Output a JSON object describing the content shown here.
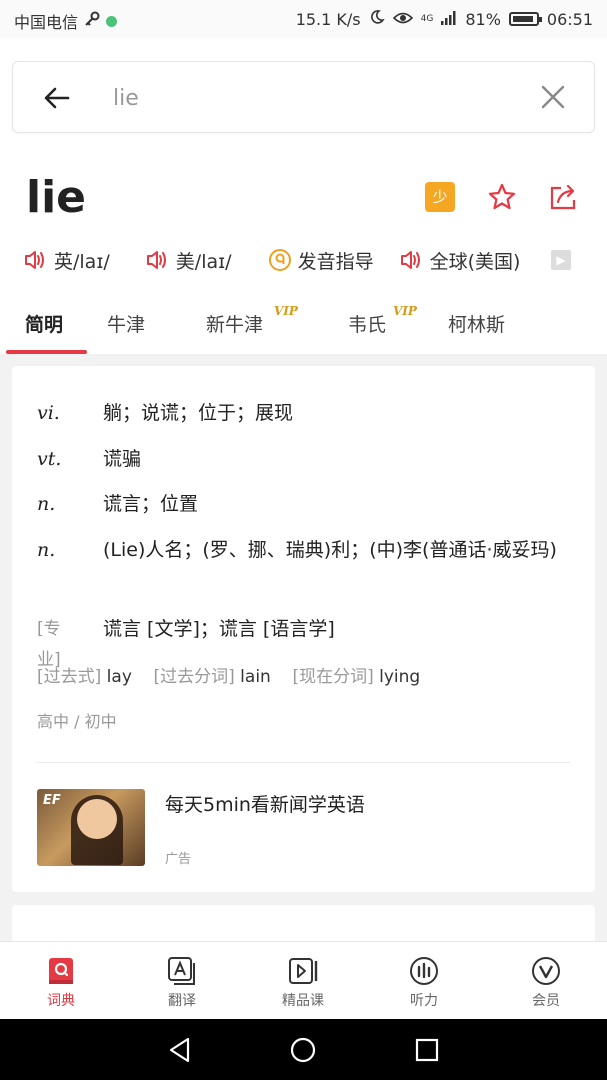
{
  "status_bar": {
    "carrier": "中国电信",
    "speed": "15.1 K/s",
    "network": "4G",
    "battery": "81%",
    "time": "06:51"
  },
  "search": {
    "value": "lie",
    "back_icon": "arrow-left-icon",
    "clear_icon": "close-icon"
  },
  "word": {
    "headword": "lie",
    "badge": "少"
  },
  "pronunciations": [
    {
      "label": "英/laɪ/",
      "icon": "speaker-icon"
    },
    {
      "label": "美/laɪ/",
      "icon": "speaker-icon"
    },
    {
      "label": "发音指导",
      "icon": "pronunciation-guide-icon"
    },
    {
      "label": "全球(美国)",
      "icon": "speaker-icon"
    }
  ],
  "tabs": [
    {
      "label": "简明",
      "vip": ""
    },
    {
      "label": "牛津",
      "vip": ""
    },
    {
      "label": "新牛津",
      "vip": "VIP"
    },
    {
      "label": "韦氏",
      "vip": "VIP"
    },
    {
      "label": "柯林斯",
      "vip": ""
    }
  ],
  "definitions": [
    {
      "pos": "vi.",
      "meaning": "躺；说谎；位于；展现"
    },
    {
      "pos": "vt.",
      "meaning": "谎骗"
    },
    {
      "pos": "n.",
      "meaning": "谎言；位置"
    },
    {
      "pos": "n.",
      "meaning": "(Lie)人名；(罗、挪、瑞典)利；(中)李(普通话·威妥玛)"
    }
  ],
  "specialty": {
    "tag": "[专业]",
    "meaning": "谎言 [文学]；谎言 [语言学]"
  },
  "forms": {
    "past_label": "[过去式]",
    "past": "lay",
    "pp_label": "[过去分词]",
    "pp": "lain",
    "pres_label": "[现在分词]",
    "pres": "lying"
  },
  "level": "高中 / 初中",
  "ad": {
    "brand": "EF",
    "title": "每天5min看新闻学英语",
    "label": "广告"
  },
  "bottom_nav": [
    {
      "label": "词典",
      "icon": "dictionary-icon",
      "active": true
    },
    {
      "label": "翻译",
      "icon": "translate-icon",
      "active": false
    },
    {
      "label": "精品课",
      "icon": "video-course-icon",
      "active": false
    },
    {
      "label": "听力",
      "icon": "listening-icon",
      "active": false
    },
    {
      "label": "会员",
      "icon": "vip-icon",
      "active": false
    }
  ],
  "colors": {
    "accent": "#e53944",
    "badge": "#f5a623",
    "vip": "#d89a1b"
  }
}
